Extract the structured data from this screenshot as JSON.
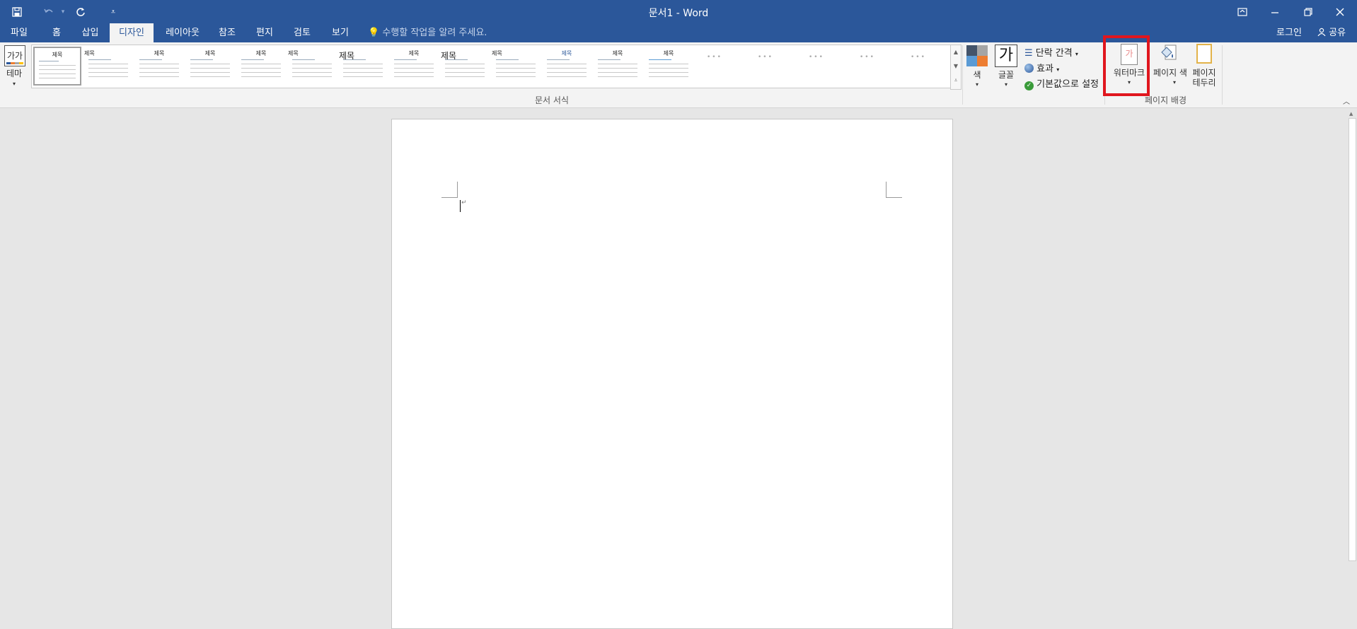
{
  "window": {
    "title": "문서1 - Word",
    "quick_access": [
      "save-icon",
      "undo-icon",
      "redo-icon",
      "customize-icon"
    ]
  },
  "tabs": [
    {
      "label": "파일"
    },
    {
      "label": "홈"
    },
    {
      "label": "삽입"
    },
    {
      "label": "디자인",
      "active": true
    },
    {
      "label": "레이아웃"
    },
    {
      "label": "참조"
    },
    {
      "label": "편지"
    },
    {
      "label": "검토"
    },
    {
      "label": "보기"
    }
  ],
  "tell_me": {
    "placeholder": "수행할 작업을 알려 주세요."
  },
  "account": {
    "login": "로그인",
    "share": "공유"
  },
  "ribbon": {
    "theme_label": "테마",
    "theme_icon_text": "가가",
    "gallery": {
      "group_label": "문서 서식",
      "thumbs": [
        "제목",
        "제목",
        "제목",
        "제목",
        "제목",
        "제목",
        "제목",
        "제목",
        "제목",
        "제목",
        "제목",
        "제목",
        "제목",
        "",
        "",
        "",
        "",
        ""
      ]
    },
    "colors_label": "색",
    "fonts_label": "글꼴",
    "fonts_icon_text": "가",
    "paragraph_spacing": "단락 간격",
    "effects": "효과",
    "set_default": "기본값으로 설정",
    "page_background": {
      "group_label": "페이지 배경",
      "watermark": "워터마크",
      "watermark_icon_text": "가",
      "page_color": "페이지 색",
      "page_borders_line1": "페이지",
      "page_borders_line2": "테두리"
    }
  },
  "colors": {
    "titlebar": "#2b579a",
    "highlight_box": "#e0161e",
    "ribbon_bg": "#f3f3f3",
    "workspace_bg": "#e6e6e6"
  }
}
